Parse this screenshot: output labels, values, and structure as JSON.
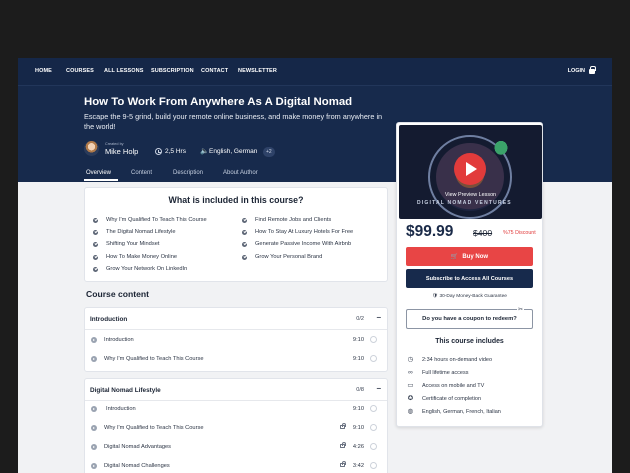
{
  "nav": {
    "items": [
      "HOME",
      "COURSES",
      "ALL LESSONS",
      "SUBSCRIPTION",
      "CONTACT",
      "NEWSLETTER"
    ],
    "login": "LOGIN"
  },
  "course": {
    "title": "How To Work From Anywhere As A Digital Nomad",
    "subtitle": "Escape the 9-5 grind, build your remote online business, and make money from anywhere in the world!",
    "created_by": "Created by",
    "author": "Mike Holp",
    "duration": "2,5 Hrs",
    "languages": "English, German",
    "more_languages": "+2"
  },
  "tabs": [
    "Overview",
    "Content",
    "Description",
    "About Author"
  ],
  "included": {
    "title": "What is included in this course?",
    "left": [
      "Why I'm Qualified To Teach This Course",
      "The Digital Nomad Lifestyle",
      "Shifting Your Mindset",
      "How To Make Money Online",
      "Grow Your Network On LinkedIn"
    ],
    "right": [
      "Find Remote Jobs and Clients",
      "How To Stay At Luxury Hotels For Free",
      "Generate Passive Income With Airbnb",
      "Grow Your Personal Brand"
    ]
  },
  "content": {
    "title": "Course content",
    "sections": [
      {
        "title": "Introduction",
        "count": "0/2",
        "toggle": "−",
        "lessons": [
          {
            "title": "Introduction",
            "time": "9:10"
          },
          {
            "title": "Why I'm Qualified to Teach This Course",
            "time": "9:10"
          }
        ]
      },
      {
        "title": "Digital Nomad Lifestyle",
        "count": "0/8",
        "toggle": "−",
        "lessons": [
          {
            "title": "Introduction",
            "time": "9:10"
          },
          {
            "title": "Why I'm Qualified to Teach This Course",
            "time": "9:10"
          },
          {
            "title": "Digital Nomad Advantages",
            "time": "4:26"
          },
          {
            "title": "Digital Nomad Challenges",
            "time": "3:42"
          }
        ]
      }
    ]
  },
  "sidebar": {
    "preview_label": "View Preview Lesson",
    "preview_badge": "DIGITAL NOMAD VENTURES",
    "price": "$99.99",
    "old_price": "$400",
    "discount": "%75 Discount",
    "buy_label": "Buy Now",
    "subscribe_label": "Subscribe to Access All Courses",
    "guarantee": "30-Day Money-Back Guarantee",
    "coupon_label": "Do you have a coupon to redeem?",
    "includes_title": "This course includes",
    "includes": [
      {
        "icon": "clock-icon",
        "text": "2:34 hours on-demand video"
      },
      {
        "icon": "infinity-icon",
        "text": "Full lifetime access"
      },
      {
        "icon": "tv-icon",
        "text": "Access on mobile and TV"
      },
      {
        "icon": "certificate-icon",
        "text": "Certificate of completion"
      },
      {
        "icon": "globe-icon",
        "text": "English, German, French, Italian"
      }
    ]
  },
  "colors": {
    "hero": "#172a4c",
    "accent_red": "#e84545",
    "page_bg": "#f1f2f4"
  }
}
